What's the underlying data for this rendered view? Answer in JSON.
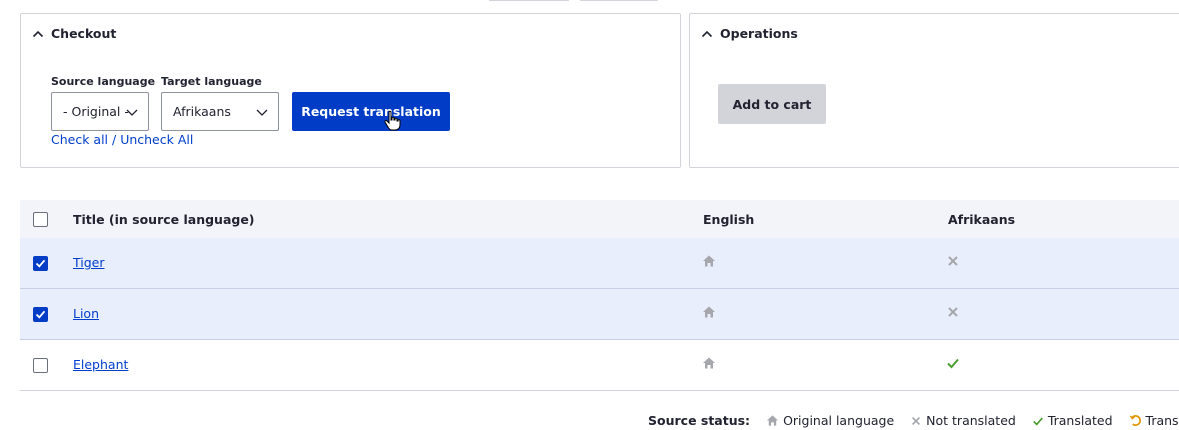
{
  "checkout": {
    "title": "Checkout",
    "source_language_label": "Source language",
    "source_language_value": "- Original -",
    "target_language_label": "Target language",
    "target_language_value": "Afrikaans",
    "request_button": "Request translation",
    "check_all": "Check all / Uncheck All"
  },
  "operations": {
    "title": "Operations",
    "add_to_cart": "Add to cart"
  },
  "table": {
    "headers": [
      "Title (in source language)",
      "English",
      "Afrikaans"
    ],
    "rows": [
      {
        "title": "Tiger",
        "checked": true,
        "english": "house-icon",
        "afrikaans": "cross-icon"
      },
      {
        "title": "Lion",
        "checked": true,
        "english": "house-icon",
        "afrikaans": "cross-icon"
      },
      {
        "title": "Elephant",
        "checked": false,
        "english": "house-icon",
        "afrikaans": "check-icon"
      }
    ]
  },
  "legend": {
    "label": "Source status:",
    "original": "Original language",
    "not_translated": "Not translated",
    "translated": "Translated",
    "outdated": "Translation C"
  },
  "colors": {
    "primary": "#003cc5",
    "link": "#003ecc",
    "selected_row": "#e8eefb",
    "translated_green": "#4a9d2f",
    "outdated_orange": "#e29700",
    "icon_gray": "#a6a7ad"
  }
}
